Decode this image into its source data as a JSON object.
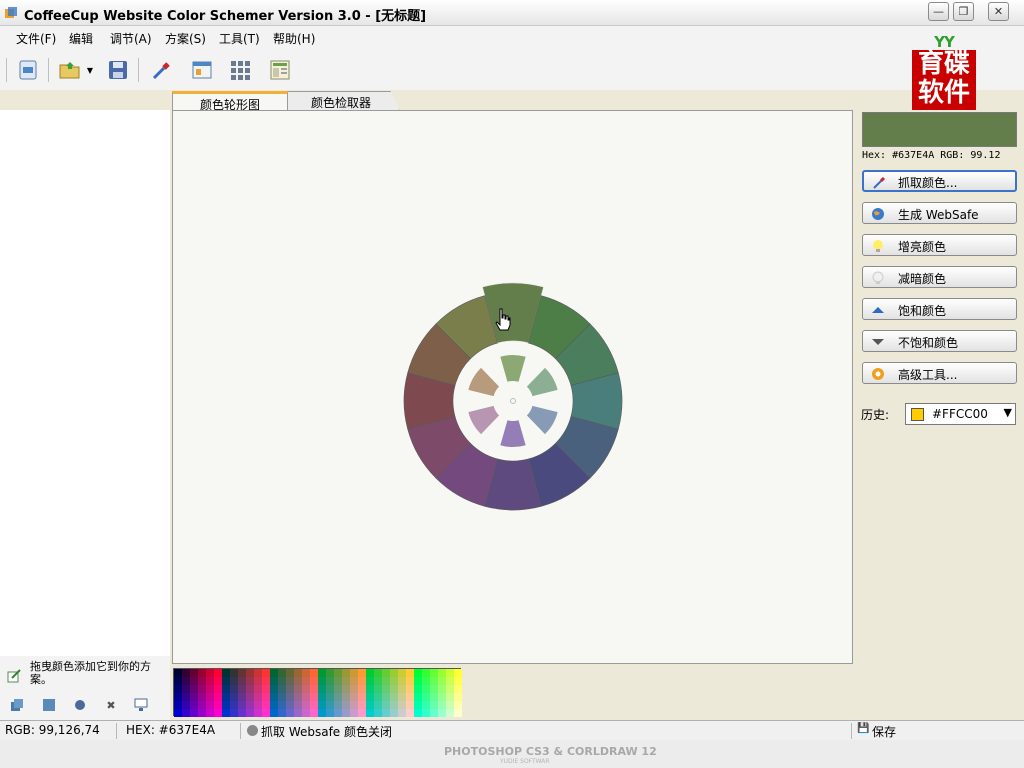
{
  "window": {
    "title": "CoffeeCup Website Color Schemer Version 3.0 - [无标题]",
    "minimize_icon": "minimize-icon",
    "maximize_icon": "restore-icon",
    "close_icon": "close-icon"
  },
  "menu": {
    "items": [
      "文件(F)",
      "编辑",
      "调节(A)",
      "方案(S)",
      "工具(T)",
      "帮助(H)"
    ]
  },
  "toolbar": {
    "icons": [
      "new-scheme-icon",
      "open-folder-icon",
      "save-icon",
      "eyedropper-icon",
      "browser-preview-icon",
      "grid-icon",
      "web-page-icon"
    ]
  },
  "logo": {
    "top": "YY",
    "line1": "育碟",
    "line2": "软件"
  },
  "tabs": [
    {
      "label": "颜色轮形图",
      "active": true
    },
    {
      "label": "颜色检取器",
      "active": false
    }
  ],
  "current_color": {
    "hex_color": "#637E4A",
    "info_text": "Hex: #637E4A  RGB: 99.12"
  },
  "actions": [
    {
      "label": "抓取颜色...",
      "icon": "eyedropper-icon"
    },
    {
      "label": "生成 WebSafe",
      "icon": "globe-icon"
    },
    {
      "label": "增亮颜色",
      "icon": "lightbulb-on-icon"
    },
    {
      "label": "减暗颜色",
      "icon": "lightbulb-off-icon"
    },
    {
      "label": "饱和颜色",
      "icon": "arrow-up-icon"
    },
    {
      "label": "不饱和颜色",
      "icon": "arrow-down-icon"
    },
    {
      "label": "高级工具...",
      "icon": "gear-icon"
    }
  ],
  "history": {
    "label": "历史:",
    "selected": "#FFCC00",
    "selected_color": "#FFCC00"
  },
  "left_panel": {
    "hint": "拖曳颜色添加它到你的方案。",
    "tools": [
      "add-color-icon",
      "copy-color-icon",
      "circle-icon",
      "delete-icon",
      "monitor-icon"
    ]
  },
  "status": {
    "rgb": "RGB: 99,126,74",
    "hex": "HEX: #637E4A",
    "mode": "抓取 Websafe 颜色关闭",
    "save": "保存"
  },
  "watermark": {
    "text": "PHOTOSHOP CS3 & CORLDRAW 12",
    "sub": "YUDIE SOFTWAR"
  },
  "wheel": {
    "outer_colors": [
      "#637E4A",
      "#4E7E48",
      "#4A7E5C",
      "#4A7E7A",
      "#4A617E",
      "#4B4A7E",
      "#5E4A7E",
      "#744A7E",
      "#7E4A6A",
      "#7E4A4F",
      "#7E5F4A",
      "#7A7E4A"
    ],
    "inner_colors": [
      "#7FA066",
      "#7FA68A",
      "#7A90B0",
      "#8A70B0",
      "#B08AA8",
      "#B09070"
    ]
  }
}
